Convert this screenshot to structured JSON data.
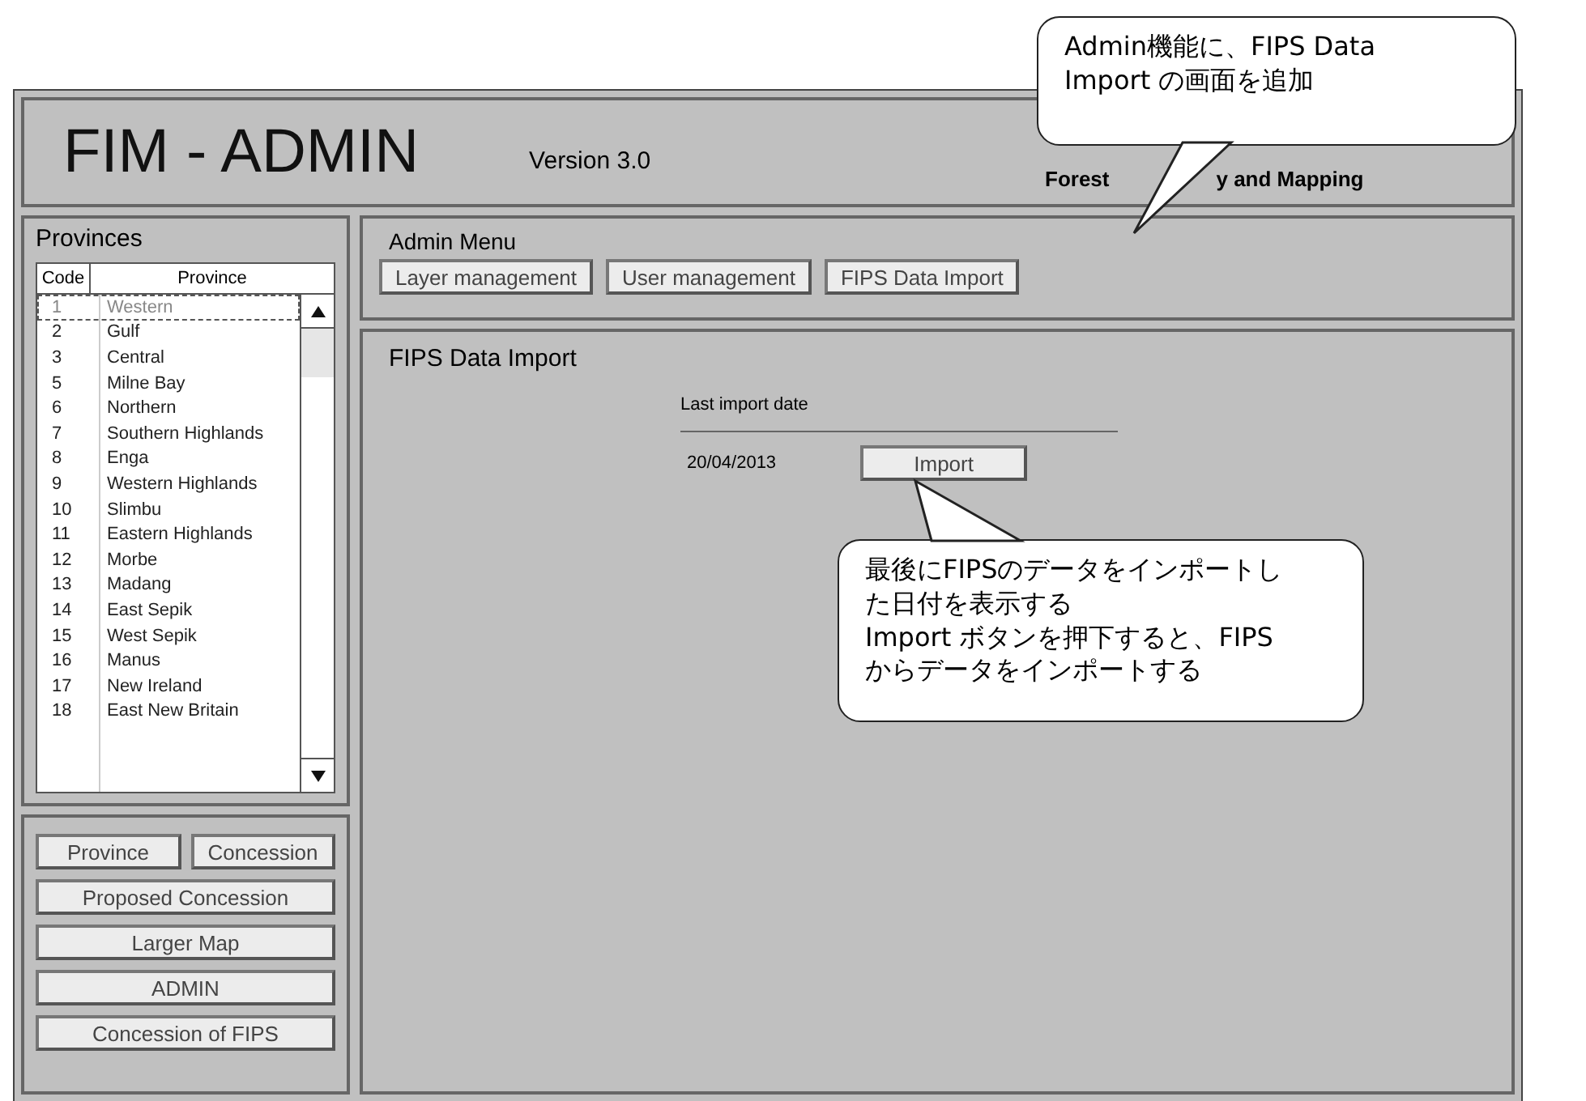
{
  "header": {
    "title": "FIM - ADMIN",
    "version": "Version 3.0",
    "subtitle_parts": [
      "Forest",
      "y and Mapping"
    ]
  },
  "provinces": {
    "title": "Provinces",
    "columns": [
      "Code",
      "Province"
    ],
    "rows": [
      {
        "code": "1",
        "name": "Western",
        "selected": true
      },
      {
        "code": "2",
        "name": "Gulf",
        "selected": false
      },
      {
        "code": "3",
        "name": "Central",
        "selected": false
      },
      {
        "code": "5",
        "name": "Milne Bay",
        "selected": false
      },
      {
        "code": "6",
        "name": "Northern",
        "selected": false
      },
      {
        "code": "7",
        "name": "Southern Highlands",
        "selected": false
      },
      {
        "code": "8",
        "name": "Enga",
        "selected": false
      },
      {
        "code": "9",
        "name": "Western Highlands",
        "selected": false
      },
      {
        "code": "10",
        "name": "Slimbu",
        "selected": false
      },
      {
        "code": "11",
        "name": "Eastern Highlands",
        "selected": false
      },
      {
        "code": "12",
        "name": "Morbe",
        "selected": false
      },
      {
        "code": "13",
        "name": "Madang",
        "selected": false
      },
      {
        "code": "14",
        "name": "East Sepik",
        "selected": false
      },
      {
        "code": "15",
        "name": "West Sepik",
        "selected": false
      },
      {
        "code": "16",
        "name": "Manus",
        "selected": false
      },
      {
        "code": "17",
        "name": "New Ireland",
        "selected": false
      },
      {
        "code": "18",
        "name": "East New Britain",
        "selected": false
      }
    ]
  },
  "nav_buttons": [
    [
      "Province",
      "Concession"
    ],
    [
      "Proposed Concession"
    ],
    [
      "Larger Map"
    ],
    [
      "ADMIN"
    ],
    [
      "Concession of FIPS"
    ]
  ],
  "admin_menu": {
    "title": "Admin Menu",
    "buttons": [
      "Layer management",
      "User management",
      "FIPS Data Import"
    ]
  },
  "content": {
    "title": "FIPS Data Import",
    "column_header": "Last import date",
    "date": "20/04/2013",
    "button": "Import"
  },
  "callouts": [
    {
      "lines": [
        "Admin機能に、FIPS Data",
        "Import の画面を追加"
      ]
    },
    {
      "lines": [
        "最後にFIPSのデータをインポートし",
        "た日付を表示する",
        "Import ボタンを押下すると、FIPS",
        "からデータをインポートする"
      ]
    }
  ]
}
